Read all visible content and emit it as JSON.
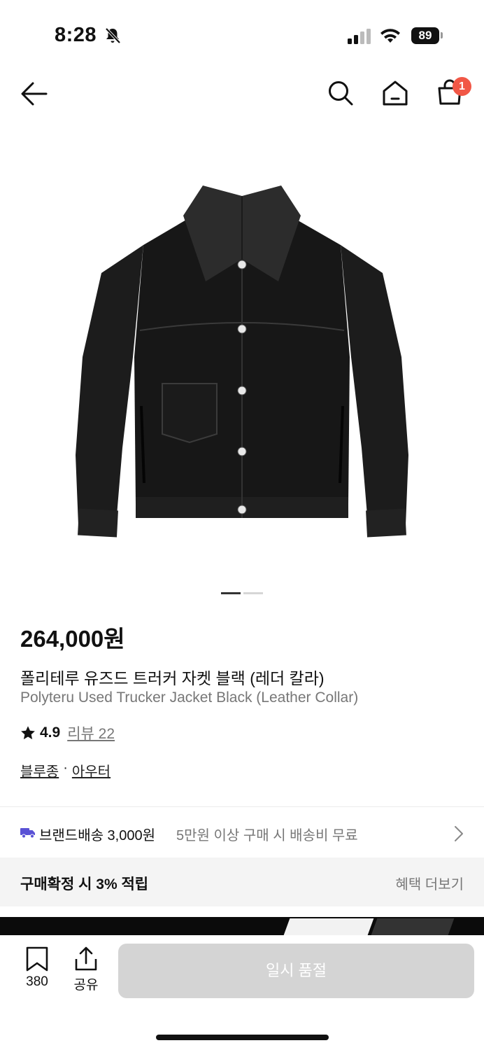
{
  "status_bar": {
    "time": "8:28",
    "battery": "89"
  },
  "nav": {
    "cart_badge": "1"
  },
  "gallery": {
    "total": 2,
    "current": 1
  },
  "product": {
    "price": "264,000원",
    "name_ko": "폴리테루 유즈드 트러커 자켓 블랙 (레더 칼라)",
    "name_en": "Polyteru Used Trucker Jacket Black (Leather Collar)",
    "rating": "4.9",
    "review_label": "리뷰 22",
    "category_1": "블루종",
    "category_sep": "·",
    "category_2": "아우터"
  },
  "shipping": {
    "label": "브랜드배송 3,000원",
    "sub": "5만원 이상 구매 시 배송비 무료"
  },
  "benefit": {
    "label": "구매확정 시 3% 적립",
    "more": "혜택 더보기"
  },
  "bottom": {
    "bookmark_count": "380",
    "share_label": "공유",
    "button_label": "일시 품절"
  },
  "colors": {
    "badge": "#f15746",
    "shipping_icon": "#5a52d5",
    "disabled_button": "#d4d4d4"
  }
}
